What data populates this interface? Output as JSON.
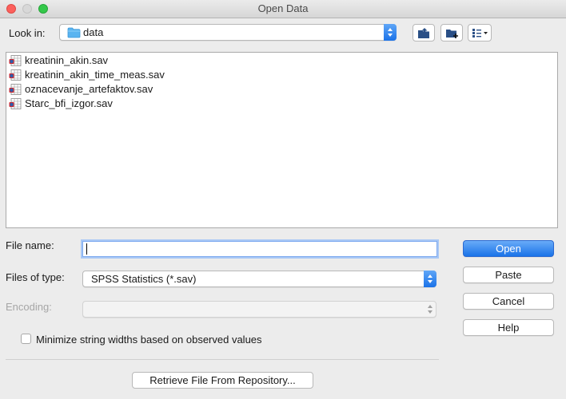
{
  "window": {
    "title": "Open Data"
  },
  "look_in": {
    "label": "Look in:",
    "value": "data"
  },
  "files": [
    {
      "name": "kreatinin_akin.sav"
    },
    {
      "name": "kreatinin_akin_time_meas.sav"
    },
    {
      "name": "oznacevanje_artefaktov.sav"
    },
    {
      "name": "Starc_bfi_izgor.sav"
    }
  ],
  "file_name": {
    "label": "File name:",
    "value": ""
  },
  "files_of_type": {
    "label": "Files of type:",
    "value": "SPSS Statistics (*.sav)"
  },
  "encoding": {
    "label": "Encoding:",
    "value": ""
  },
  "minimize_strings": {
    "label": "Minimize string widths based on observed values",
    "checked": false
  },
  "buttons": {
    "open": "Open",
    "paste": "Paste",
    "cancel": "Cancel",
    "help": "Help",
    "retrieve": "Retrieve File From Repository..."
  },
  "colors": {
    "accent": "#1a73e8",
    "folder": "#5ab4f0"
  }
}
